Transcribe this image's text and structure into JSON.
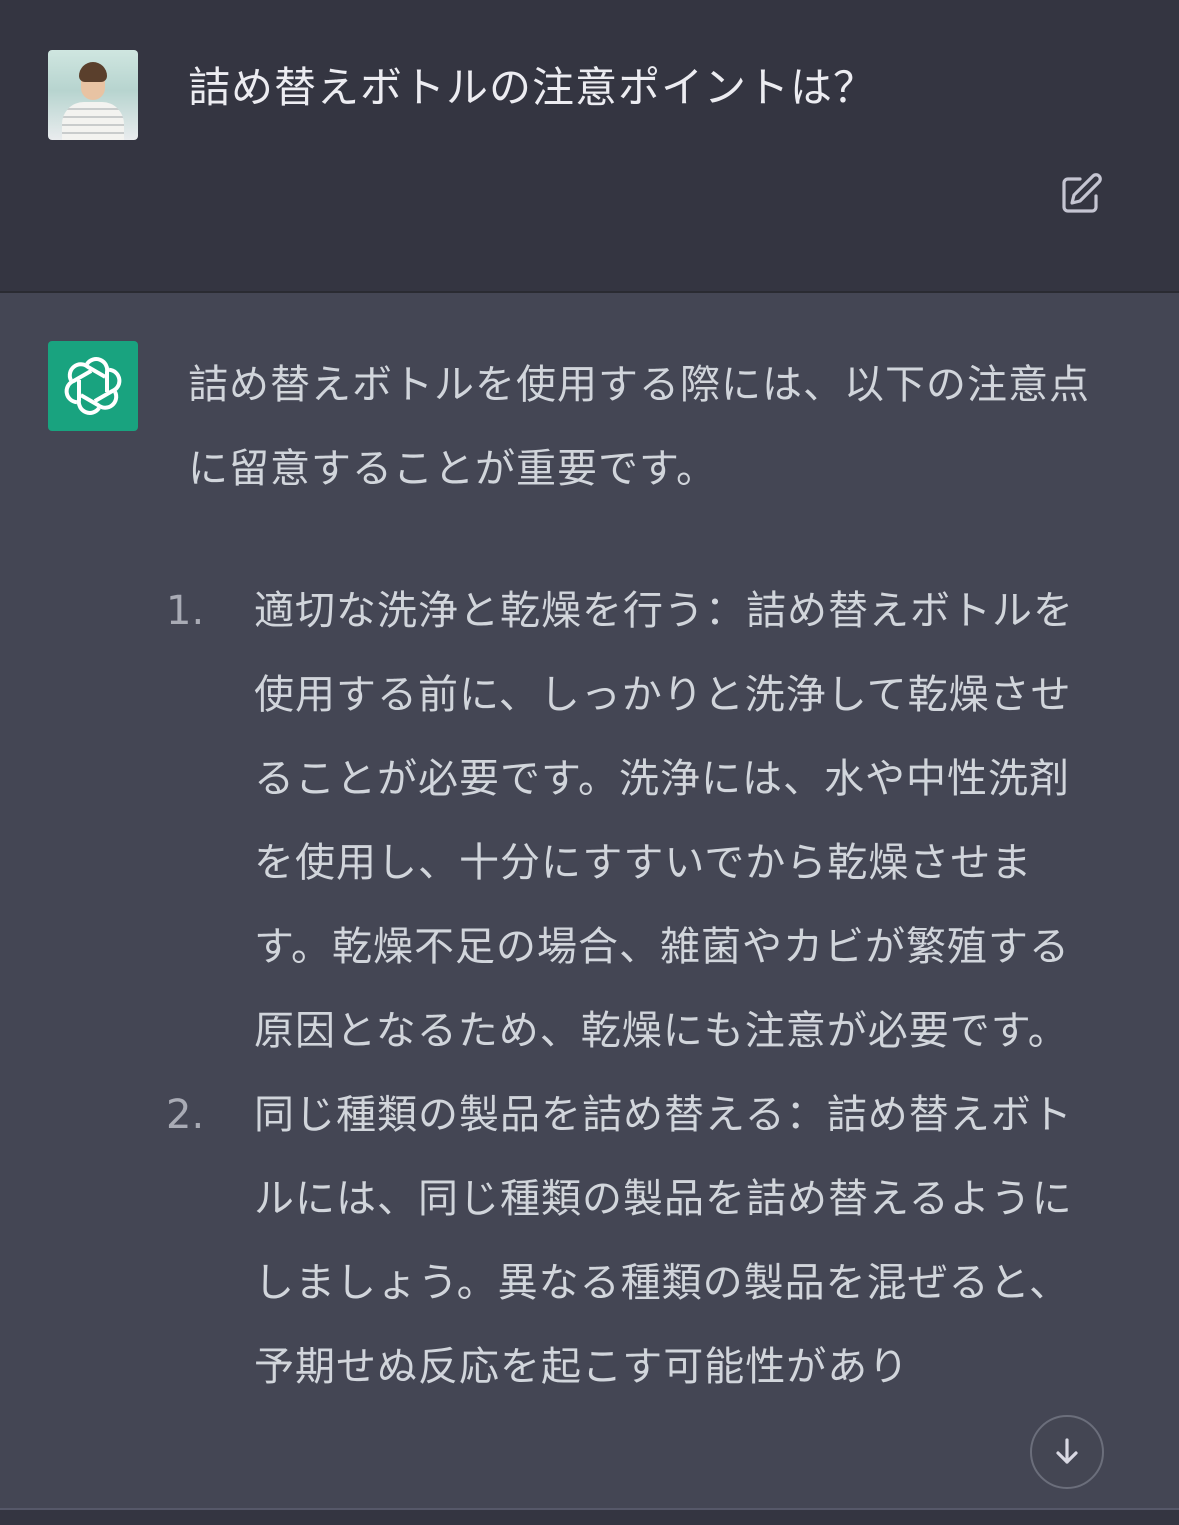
{
  "user_message": {
    "text": "詰め替えボトルの注意ポイントは？"
  },
  "assistant_message": {
    "intro": "詰め替えボトルを使用する際には、以下の注意点に留意することが重要です。",
    "items": [
      {
        "number": "1.",
        "text": "適切な洗浄と乾燥を行う：詰め替えボトルを使用する前に、しっかりと洗浄して乾燥させることが必要です。洗浄には、水や中性洗剤を使用し、十分にすすいでから乾燥させます。乾燥不足の場合、雑菌やカビが繁殖する原因となるため、乾燥にも注意が必要です。"
      },
      {
        "number": "2.",
        "text": "同じ種類の製品を詰め替える：詰め替えボトルには、同じ種類の製品を詰め替えるようにしましょう。異なる種類の製品を混ぜると、予期せぬ反応を起こす可能性があり"
      }
    ]
  },
  "icons": {
    "user_avatar": "user-photo-avatar",
    "assistant_avatar": "openai-logo-icon",
    "edit": "edit-icon",
    "scroll_down": "arrow-down-icon"
  },
  "colors": {
    "user_bg": "#343541",
    "assistant_bg": "#444654",
    "gpt_green": "#19a37f",
    "text_primary": "#ececf1",
    "text_secondary": "#d1d5db"
  }
}
